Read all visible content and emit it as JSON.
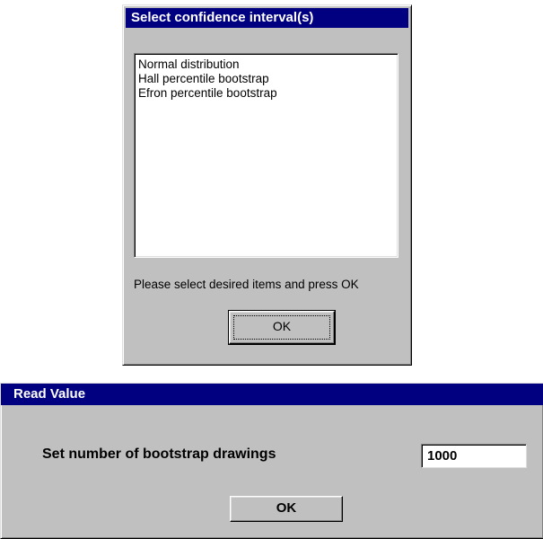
{
  "ci_dialog": {
    "title": "Select confidence interval(s)",
    "items": [
      "Normal distribution",
      "Hall percentile bootstrap",
      "Efron percentile bootstrap"
    ],
    "prompt": "Please select desired items and press OK",
    "ok_label": "OK"
  },
  "read_dialog": {
    "title": "Read Value",
    "field_label": "Set number of bootstrap drawings",
    "value": "1000",
    "ok_label": "OK"
  }
}
